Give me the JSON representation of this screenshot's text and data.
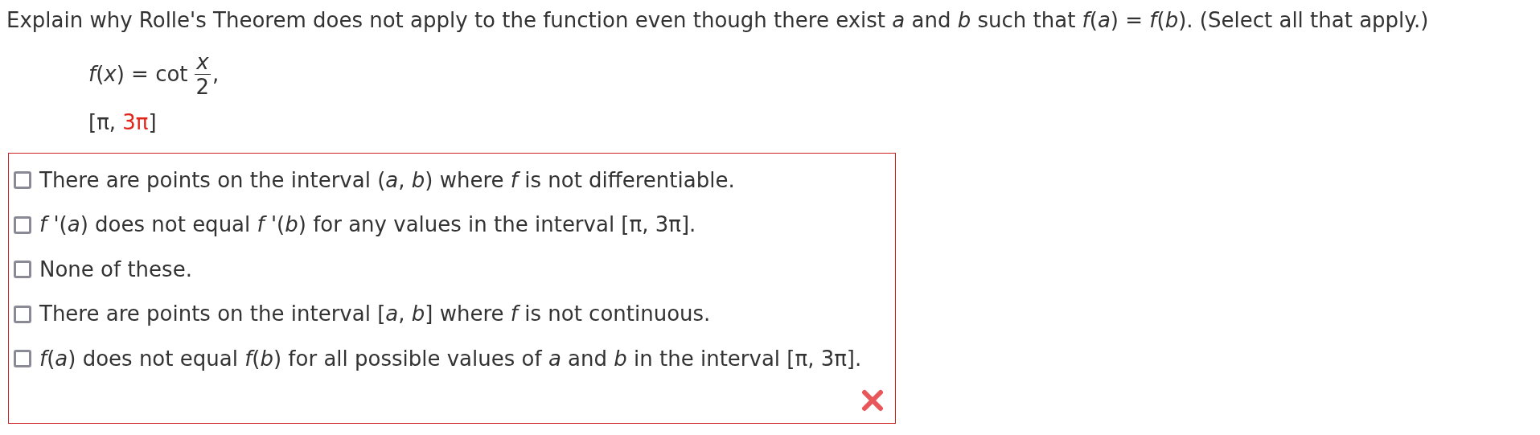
{
  "question": "Explain why Rolle's Theorem does not apply to the function even though there exist *a* and *b* such that *f*(*a*) = *f*(*b*). (Select all that apply.)",
  "formula": {
    "lhs": "*f*(*x*) = cot",
    "numerator": "x",
    "denominator": "2",
    "trailing": ","
  },
  "interval": [
    {
      "text": "[π, ",
      "highlighted": false
    },
    {
      "text": "3π",
      "highlighted": true
    },
    {
      "text": "]",
      "highlighted": false
    }
  ],
  "answer": {
    "marked_incorrect": true,
    "options": [
      {
        "text": "There are points on the interval (*a*, *b*) where *f* is not differentiable.",
        "checked": false
      },
      {
        "text": "*f* '(*a*) does not equal *f* '(*b*) for any values in the interval [π, 3π].",
        "checked": false
      },
      {
        "text": "None of these.",
        "checked": false
      },
      {
        "text": "There are points on the interval [*a*, *b*] where *f* is not continuous.",
        "checked": false
      },
      {
        "text": "*f*(*a*) does not equal *f*(*b*) for all possible values of *a* and *b* in the interval [π, 3π].",
        "checked": false
      }
    ]
  }
}
